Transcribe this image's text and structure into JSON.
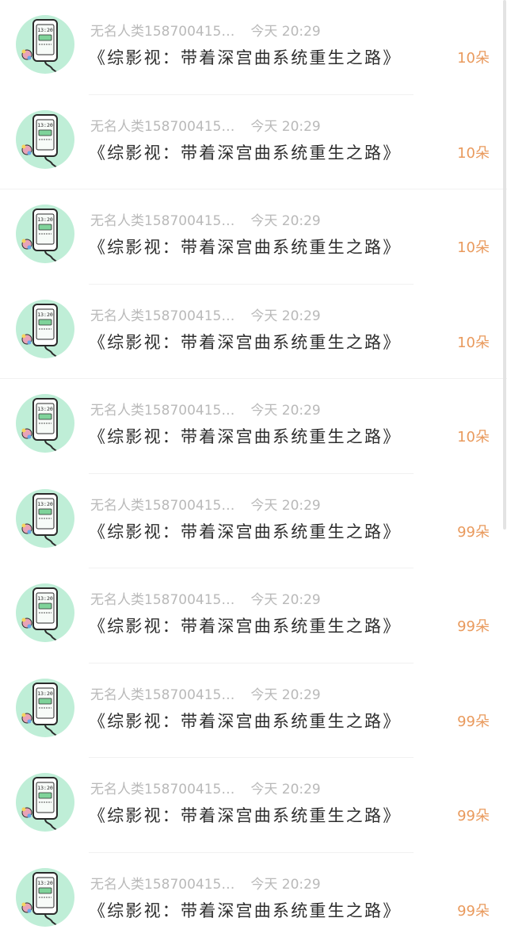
{
  "items": [
    {
      "author": "无名人类158700415…",
      "time": "今天 20:29",
      "title": "《综影视：带着深宫曲系统重生之路》",
      "count": "10朵",
      "divider": "short"
    },
    {
      "author": "无名人类158700415…",
      "time": "今天 20:29",
      "title": "《综影视：带着深宫曲系统重生之路》",
      "count": "10朵",
      "divider": "full"
    },
    {
      "author": "无名人类158700415…",
      "time": "今天 20:29",
      "title": "《综影视：带着深宫曲系统重生之路》",
      "count": "10朵",
      "divider": "short"
    },
    {
      "author": "无名人类158700415…",
      "time": "今天 20:29",
      "title": "《综影视：带着深宫曲系统重生之路》",
      "count": "10朵",
      "divider": "full"
    },
    {
      "author": "无名人类158700415…",
      "time": "今天 20:29",
      "title": "《综影视：带着深宫曲系统重生之路》",
      "count": "10朵",
      "divider": "short"
    },
    {
      "author": "无名人类158700415…",
      "time": "今天 20:29",
      "title": "《综影视：带着深宫曲系统重生之路》",
      "count": "99朵",
      "divider": "short"
    },
    {
      "author": "无名人类158700415…",
      "time": "今天 20:29",
      "title": "《综影视：带着深宫曲系统重生之路》",
      "count": "99朵",
      "divider": "short"
    },
    {
      "author": "无名人类158700415…",
      "time": "今天 20:29",
      "title": "《综影视：带着深宫曲系统重生之路》",
      "count": "99朵",
      "divider": "short"
    },
    {
      "author": "无名人类158700415…",
      "time": "今天 20:29",
      "title": "《综影视：带着深宫曲系统重生之路》",
      "count": "99朵",
      "divider": "short"
    },
    {
      "author": "无名人类158700415…",
      "time": "今天 20:29",
      "title": "《综影视：带着深宫曲系统重生之路》",
      "count": "99朵",
      "divider": "none"
    }
  ],
  "avatar": {
    "icon": "phone-charging-icon",
    "screen_time": "13:20",
    "background_color": "#bfeed7"
  },
  "colors": {
    "meta_text": "#b9b9b9",
    "title_text": "#2d2d2d",
    "count_text": "#e99a5d",
    "divider": "#f1f1f1"
  }
}
